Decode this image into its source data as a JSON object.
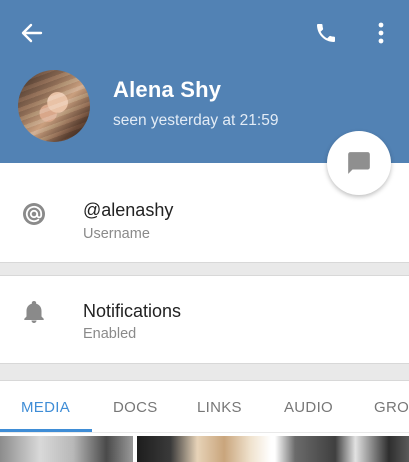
{
  "header": {
    "back_icon": "arrow-left-icon",
    "call_icon": "phone-icon",
    "more_icon": "more-vertical-icon",
    "background_color": "#5282b4"
  },
  "profile": {
    "name": "Alena Shy",
    "status": "seen yesterday at 21:59"
  },
  "fab": {
    "icon": "message-icon"
  },
  "username": {
    "value": "@alenashy",
    "label": "Username",
    "icon": "at-sign-icon"
  },
  "notifications": {
    "title": "Notifications",
    "value": "Enabled",
    "icon": "bell-icon"
  },
  "tabs": [
    {
      "label": "MEDIA",
      "active": true
    },
    {
      "label": "DOCS",
      "active": false
    },
    {
      "label": "LINKS",
      "active": false
    },
    {
      "label": "AUDIO",
      "active": false
    },
    {
      "label": "GROU",
      "active": false
    }
  ],
  "accent_color": "#3f8dd6"
}
